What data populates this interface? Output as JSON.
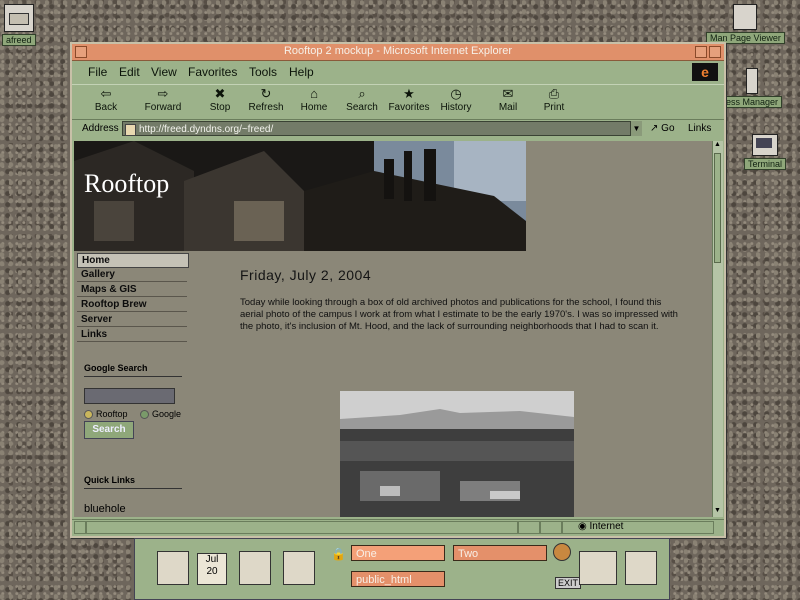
{
  "desktop": {
    "icons": [
      {
        "label": "afreed"
      },
      {
        "label": "Man Page Viewer"
      },
      {
        "label": "ess Manager"
      },
      {
        "label": "Terminal"
      }
    ]
  },
  "window": {
    "title": "Rooftop 2 mockup - Microsoft Internet Explorer",
    "menu": [
      "File",
      "Edit",
      "View",
      "Favorites",
      "Tools",
      "Help"
    ],
    "toolbar": [
      {
        "label": "Back",
        "icon": "⇦"
      },
      {
        "label": "Forward",
        "icon": "⇨"
      },
      {
        "label": "Stop",
        "icon": "✖"
      },
      {
        "label": "Refresh",
        "icon": "↻"
      },
      {
        "label": "Home",
        "icon": "⌂"
      },
      {
        "label": "Search",
        "icon": "⌕"
      },
      {
        "label": "Favorites",
        "icon": "★"
      },
      {
        "label": "History",
        "icon": "◷"
      },
      {
        "label": "Mail",
        "icon": "✉"
      },
      {
        "label": "Print",
        "icon": "⎙"
      }
    ],
    "address_label": "Address",
    "address_value": "http://freed.dyndns.org/~freed/",
    "go_label": "Go",
    "links_label": "Links",
    "status_zone": "Internet"
  },
  "page": {
    "site_title": "Rooftop",
    "nav": [
      "Home",
      "Gallery",
      "Maps & GIS",
      "Rooftop Brew",
      "Server",
      "Links"
    ],
    "google_search_heading": "Google Search",
    "radio_rooftop": "Rooftop",
    "radio_google": "Google",
    "search_button": "Search",
    "quick_links_heading": "Quick Links",
    "quick_link_1": "bluehole",
    "post_date": "Friday, July 2, 2004",
    "post_text": "Today while looking through a box of old archived photos and publications for the school, I found this aerial photo of the campus I work at from what I estimate to be the early 1970's. I was so impressed with the photo, it's inclusion of Mt. Hood, and the lack of surrounding neighborhoods that I had to scan it."
  },
  "panel": {
    "clock_month": "Jul",
    "clock_day": "20",
    "workspaces": [
      "One",
      "Two",
      "public_html"
    ],
    "exit_label": "EXIT"
  },
  "colors": {
    "window_body": "#9cb28a",
    "titlebar": "#e0906a",
    "page_bg": "#8b8778"
  }
}
